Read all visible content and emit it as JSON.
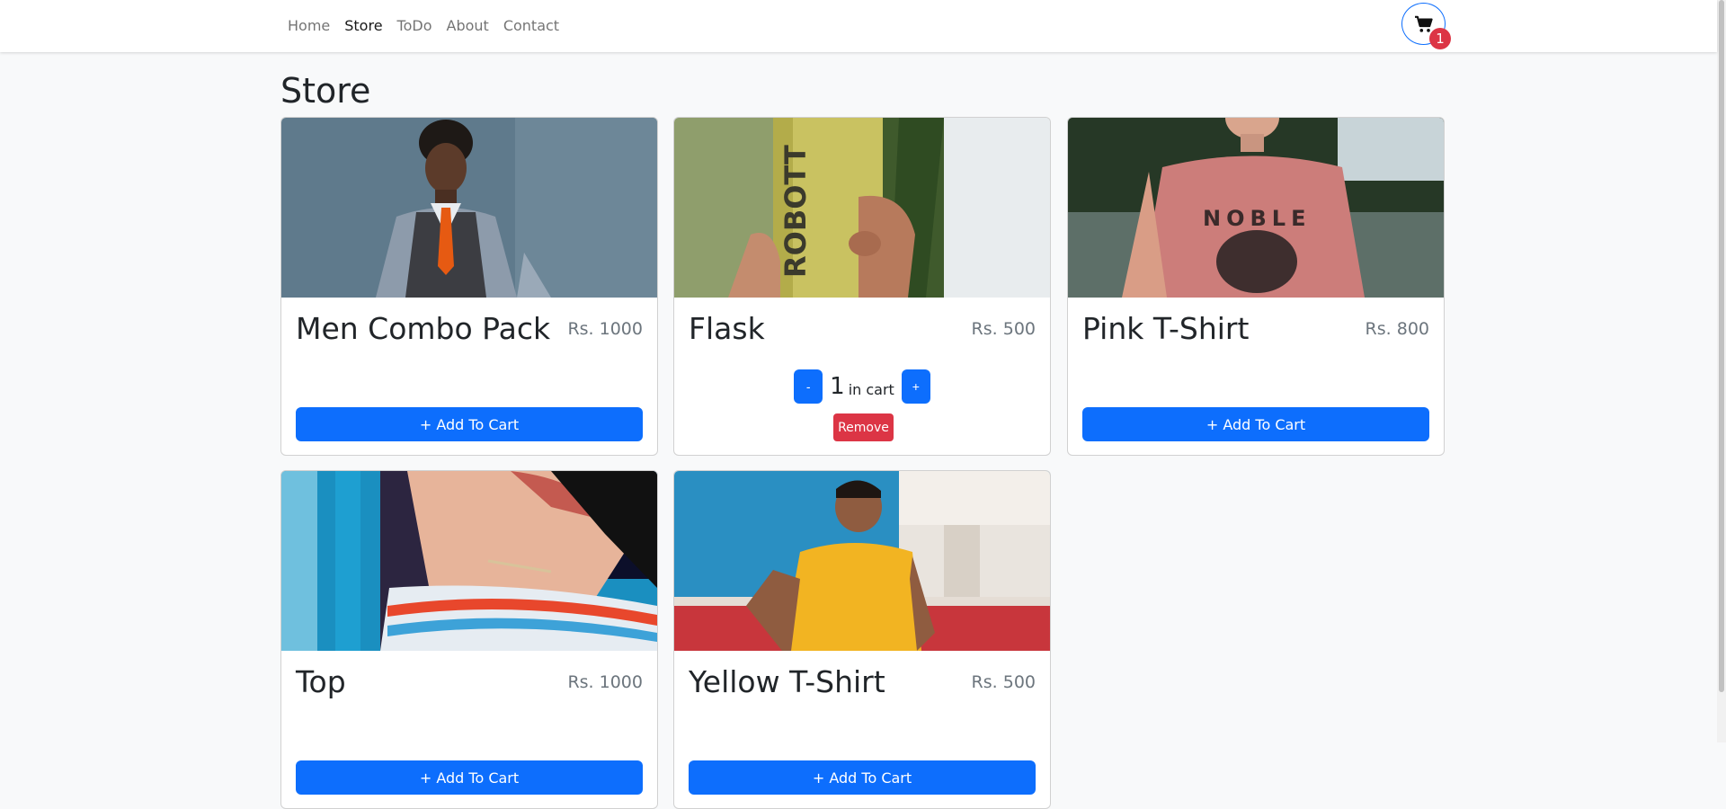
{
  "nav": {
    "links": [
      "Home",
      "Store",
      "ToDo",
      "About",
      "Contact"
    ],
    "active": "Store"
  },
  "cart": {
    "icon": "cart-icon",
    "count": "1"
  },
  "page": {
    "title": "Store"
  },
  "products": [
    {
      "name": "Men Combo Pack",
      "price": "Rs. 1000",
      "add_label": "+ Add To Cart"
    },
    {
      "name": "Flask",
      "price": "Rs. 500",
      "in_cart": {
        "decrement": "-",
        "quantity": "1",
        "label": "in cart",
        "increment": "+",
        "remove": "Remove"
      }
    },
    {
      "name": "Pink T-Shirt",
      "price": "Rs. 800",
      "add_label": "+ Add To Cart"
    },
    {
      "name": "Top",
      "price": "Rs. 1000",
      "add_label": "+ Add To Cart"
    },
    {
      "name": "Yellow T-Shirt",
      "price": "Rs. 500",
      "add_label": "+ Add To Cart"
    }
  ],
  "colors": {
    "primary": "#0d6efd",
    "danger": "#dc3545",
    "background": "#f8f9fa"
  }
}
